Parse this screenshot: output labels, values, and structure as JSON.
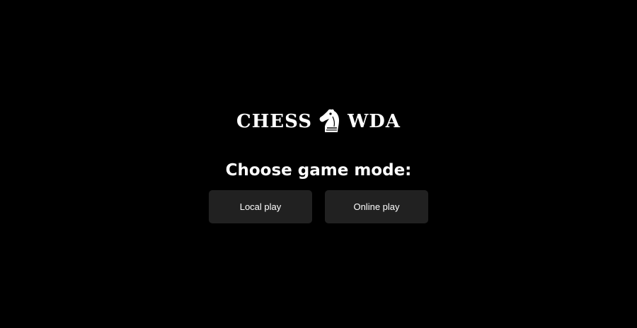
{
  "logo": {
    "left_text": "CHESS",
    "right_text": "WDA",
    "icon": "knight-icon"
  },
  "heading": "Choose game mode:",
  "buttons": {
    "local_play": "Local play",
    "online_play": "Online play"
  },
  "colors": {
    "background": "#000000",
    "button_background": "#212121",
    "text": "#ffffff"
  }
}
